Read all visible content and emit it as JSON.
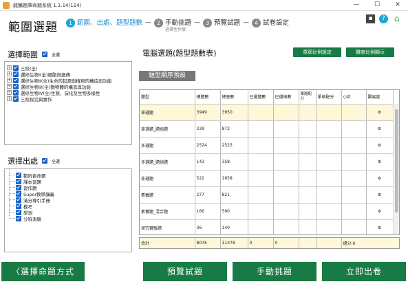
{
  "window": {
    "title": "龍騰題庫命題系統 1.1.14(114)",
    "minimize": "—",
    "maximize": "☐",
    "close": "✕"
  },
  "header": {
    "page_title": "範圍選題",
    "steps": [
      {
        "num": "1",
        "label": "範圍、出處、題型題數",
        "sub": ""
      },
      {
        "num": "2",
        "label": "手動挑題",
        "sub": "選擇性步驟"
      },
      {
        "num": "3",
        "label": "預覽試題",
        "sub": ""
      },
      {
        "num": "4",
        "label": "試卷設定",
        "sub": ""
      }
    ],
    "step_sep": "—",
    "icons": {
      "save": "save-icon",
      "help": "help-icon",
      "home": "home-icon"
    }
  },
  "scope": {
    "title": "選擇範圍",
    "all_label": "全選",
    "items": [
      "三校(全)",
      "選修生物I(全)細胞與遺傳",
      "選修生物II(全)生命的起源與植物的構造與功能",
      "選修生物III(全)動物體的構造與功能",
      "選修生物IV(全)生態、演化及生物多樣性",
      "三校探究與實作"
    ]
  },
  "source": {
    "title": "選擇出處",
    "all_label": "全選",
    "items": [
      "範例自命題",
      "課本習題",
      "習作題",
      "Super教學講義",
      "滿分導引手冊",
      "模考",
      "學測",
      "分科測驗"
    ]
  },
  "main": {
    "title": "電腦選題(題型題數表)",
    "btn_chapter_ratio": "章節比例設定",
    "btn_difficulty_ratio": "難度比例顯示",
    "btn_type_order": "題型順序預設",
    "columns": [
      "題型",
      "總題數",
      "總答數",
      "已選題數",
      "已選格數",
      "單題配分",
      "單格配分",
      "小計",
      "難易度"
    ],
    "rows": [
      {
        "type": "單選題",
        "total_q": "3949",
        "total_a": "3950"
      },
      {
        "type": "單選題_題組題",
        "total_q": "339",
        "total_a": "872"
      },
      {
        "type": "多選題",
        "total_q": "2524",
        "total_a": "2525"
      },
      {
        "type": "多選題_題組題",
        "total_q": "143",
        "total_a": "358"
      },
      {
        "type": "非選題",
        "total_q": "522",
        "total_a": "1658"
      },
      {
        "type": "素養題",
        "total_q": "277",
        "total_a": "821"
      },
      {
        "type": "素養題_混合題",
        "total_q": "166",
        "total_a": "590"
      },
      {
        "type": "探究實驗題",
        "total_q": "36",
        "total_a": "140"
      }
    ],
    "total": {
      "label": "合計",
      "total_q": "8076",
      "total_a": "11378",
      "selected_q": "0",
      "selected_cells": "0",
      "score": "總分:0"
    }
  },
  "footer": {
    "back": "選擇命題方式",
    "preview": "預覽試題",
    "manual": "手動挑題",
    "publish": "立即出卷"
  },
  "colors": {
    "accent_green": "#187a44",
    "step_active": "#1aa6d8",
    "checkbox": "#1a62c8",
    "highlight_row": "#fff8d8"
  }
}
